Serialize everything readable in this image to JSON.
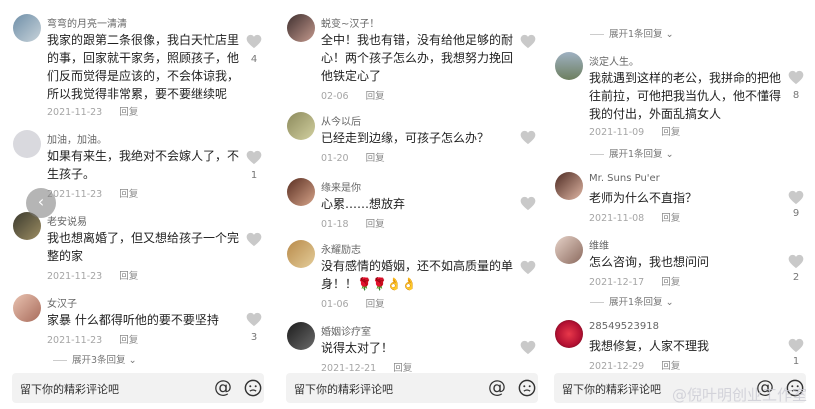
{
  "panels": [
    {
      "comments": [
        {
          "user": "弯弯的月亮一清清",
          "text": "我家的跟第二条很像，我白天忙店里的事，回家就干家务，照顾孩子，他们反而觉得是应该的，不会体谅我，所以我觉得非常累，要不要继续呢",
          "date": "2021-11-23",
          "reply": "回复",
          "likes": "4"
        },
        {
          "user": "加油，加油。",
          "text": "如果有来生，我绝对不会嫁人了，不生孩子。",
          "date": "2021-11-23",
          "reply": "回复",
          "likes": "1"
        },
        {
          "user": "老安说易",
          "text": "我也想离婚了，但又想给孩子一个完整的家",
          "date": "2021-11-23",
          "reply": "回复",
          "likes": ""
        },
        {
          "user": "女汉子",
          "text": "家暴 什么都得听他的要不要坚持",
          "date": "2021-11-23",
          "reply": "回复",
          "likes": "3"
        }
      ],
      "expand": "展开3条回复",
      "input_placeholder": "留下你的精彩评论吧"
    },
    {
      "top_expand": "",
      "comments": [
        {
          "user": "蜕变~汉子！",
          "text": "全中！我也有错，没有给他足够的耐心！两个孩子怎么办，我想努力挽回他铁定心了",
          "date": "02-06",
          "reply": "回复",
          "likes": ""
        },
        {
          "user": "从今以后",
          "text": "已经走到边缘，可孩子怎么办？",
          "date": "01-20",
          "reply": "回复",
          "likes": ""
        },
        {
          "user": "缘来是你",
          "text": "心累……想放弃",
          "date": "01-18",
          "reply": "回复",
          "likes": ""
        },
        {
          "user": "永耀励志",
          "text": "没有感情的婚姻，还不如高质量的单身！！",
          "emojis": "🌹🌹👌👌",
          "date": "01-06",
          "reply": "回复",
          "likes": ""
        },
        {
          "user": "婚姻诊疗室",
          "text": "说得太对了！",
          "date": "2021-12-21",
          "reply": "回复",
          "likes": ""
        }
      ],
      "input_placeholder": "留下你的精彩评论吧"
    },
    {
      "top_expand": "展开1条回复",
      "comments": [
        {
          "user": "淡定人生。",
          "text": "我就遇到这样的老公，我拼命的把他往前拉，可他把我当仇人，他不懂得我的付出，外面乱搞女人",
          "date": "2021-11-09",
          "reply": "回复",
          "likes": "8"
        },
        {
          "user": "Mr. Suns Pu'er",
          "text": "老师为什么不直指？",
          "date": "2021-11-08",
          "reply": "回复",
          "likes": "9"
        },
        {
          "user": "维维",
          "text": "怎么咨询，我也想问问",
          "date": "2021-12-17",
          "reply": "回复",
          "likes": "2"
        },
        {
          "user": "28549523918",
          "text": "我想修复，人家不理我",
          "date": "2021-12-29",
          "reply": "回复",
          "likes": "1"
        }
      ],
      "expand_1": "展开1条回复",
      "expand_2": "展开1条回复",
      "input_placeholder": "留下你的精彩评论吧"
    }
  ],
  "watermark": "@倪叶明创业工作室",
  "icons": {
    "at": "@",
    "heart": "heart-icon",
    "emoji": "emoji-icon",
    "prev": "chevron-left-icon"
  }
}
